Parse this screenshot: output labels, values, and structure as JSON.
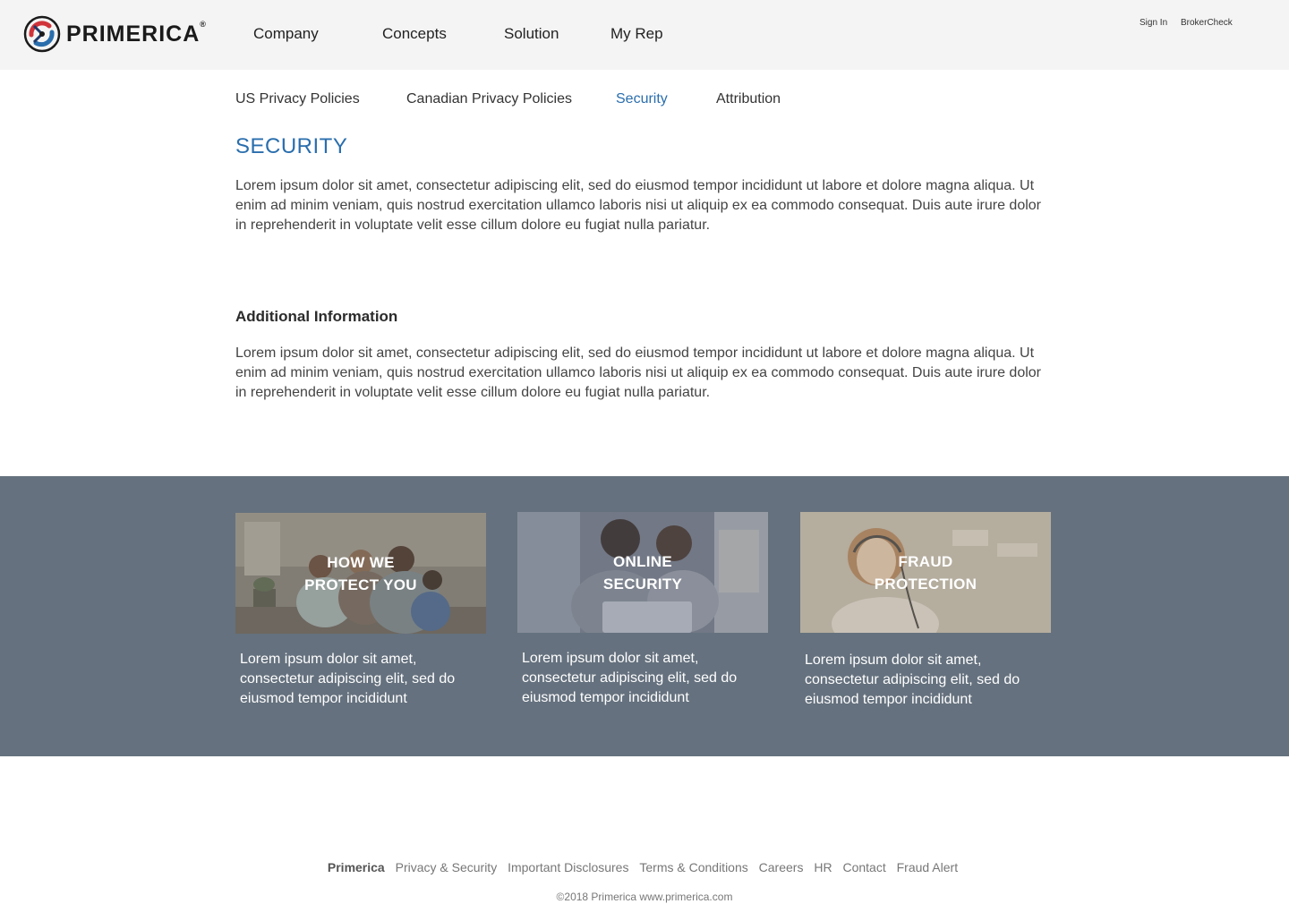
{
  "brand": {
    "name": "PRIMERICA",
    "reg": "®",
    "colors": {
      "blue": "#2a6ead",
      "red": "#d0343a",
      "navy": "#1f3a6b",
      "band": "#65717e"
    }
  },
  "header": {
    "nav": [
      "Company",
      "Concepts",
      "Solution",
      "My Rep"
    ],
    "utility": [
      "Sign In",
      "BrokerCheck"
    ]
  },
  "subnav": {
    "items": [
      "US Privacy Policies",
      "Canadian Privacy Policies",
      "Security",
      "Attribution"
    ],
    "active": "Security"
  },
  "main": {
    "title": "SECURITY",
    "intro": "Lorem ipsum dolor sit amet, consectetur adipiscing elit, sed do eiusmod tempor incididunt ut labore et dolore magna aliqua. Ut enim ad minim veniam, quis nostrud exercitation ullamco laboris nisi ut aliquip ex ea commodo consequat. Duis aute irure dolor in reprehenderit in voluptate velit esse cillum dolore eu fugiat nulla pariatur.",
    "additional_heading": "Additional Information",
    "additional_text": "Lorem ipsum dolor sit amet, consectetur adipiscing elit, sed do eiusmod tempor incididunt ut labore et dolore magna aliqua. Ut enim ad minim veniam, quis nostrud exercitation ullamco laboris nisi ut aliquip ex ea commodo consequat. Duis aute irure dolor in reprehenderit in voluptate velit esse cillum dolore eu fugiat nulla pariatur."
  },
  "cards": [
    {
      "title_line1": "HOW WE",
      "title_line2": "PROTECT YOU",
      "text": "Lorem ipsum dolor sit amet, consectetur adipiscing elit, sed do eiusmod tempor incididunt",
      "image": "family-photo"
    },
    {
      "title_line1": "ONLINE",
      "title_line2": "SECURITY",
      "text": "Lorem ipsum dolor sit amet, consectetur adipiscing elit, sed do eiusmod tempor incididunt",
      "image": "couple-laptop-photo"
    },
    {
      "title_line1": "FRAUD",
      "title_line2": "PROTECTION",
      "text": "Lorem ipsum dolor sit amet, consectetur adipiscing elit, sed do eiusmod tempor incididunt",
      "image": "support-agent-photo"
    }
  ],
  "footer": {
    "brand": "Primerica",
    "links": [
      "Privacy & Security",
      "Important Disclosures",
      "Terms & Conditions",
      "Careers",
      "HR",
      "Contact",
      "Fraud Alert"
    ],
    "copyright": "©2018 Primerica www.primerica.com"
  }
}
